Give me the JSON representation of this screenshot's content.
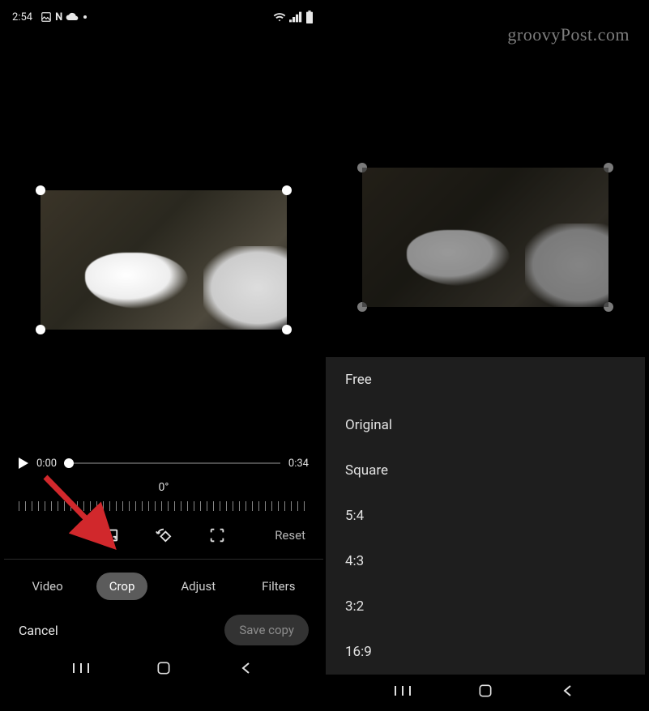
{
  "watermark": "groovyPost.com",
  "left": {
    "statusbar": {
      "time": "2:54",
      "icons": [
        "picture-icon",
        "netflix-icon",
        "cloud-icon",
        "dot-icon"
      ],
      "right_icons": [
        "wifi-icon",
        "signal-icon",
        "battery-icon"
      ]
    },
    "timeline": {
      "current": "0:00",
      "duration": "0:34"
    },
    "angle": "0°",
    "tools": {
      "aspect_ratio": "aspect-ratio-icon",
      "rotate": "rotate-icon",
      "transform": "perspective-icon"
    },
    "reset_label": "Reset",
    "tabs": [
      "Video",
      "Crop",
      "Adjust",
      "Filters"
    ],
    "active_tab": "Crop",
    "cancel_label": "Cancel",
    "save_label": "Save copy",
    "nav": [
      "recents",
      "home",
      "back"
    ]
  },
  "right": {
    "ratios": [
      "Free",
      "Original",
      "Square",
      "5:4",
      "4:3",
      "3:2",
      "16:9"
    ],
    "nav": [
      "recents",
      "home",
      "back"
    ]
  }
}
